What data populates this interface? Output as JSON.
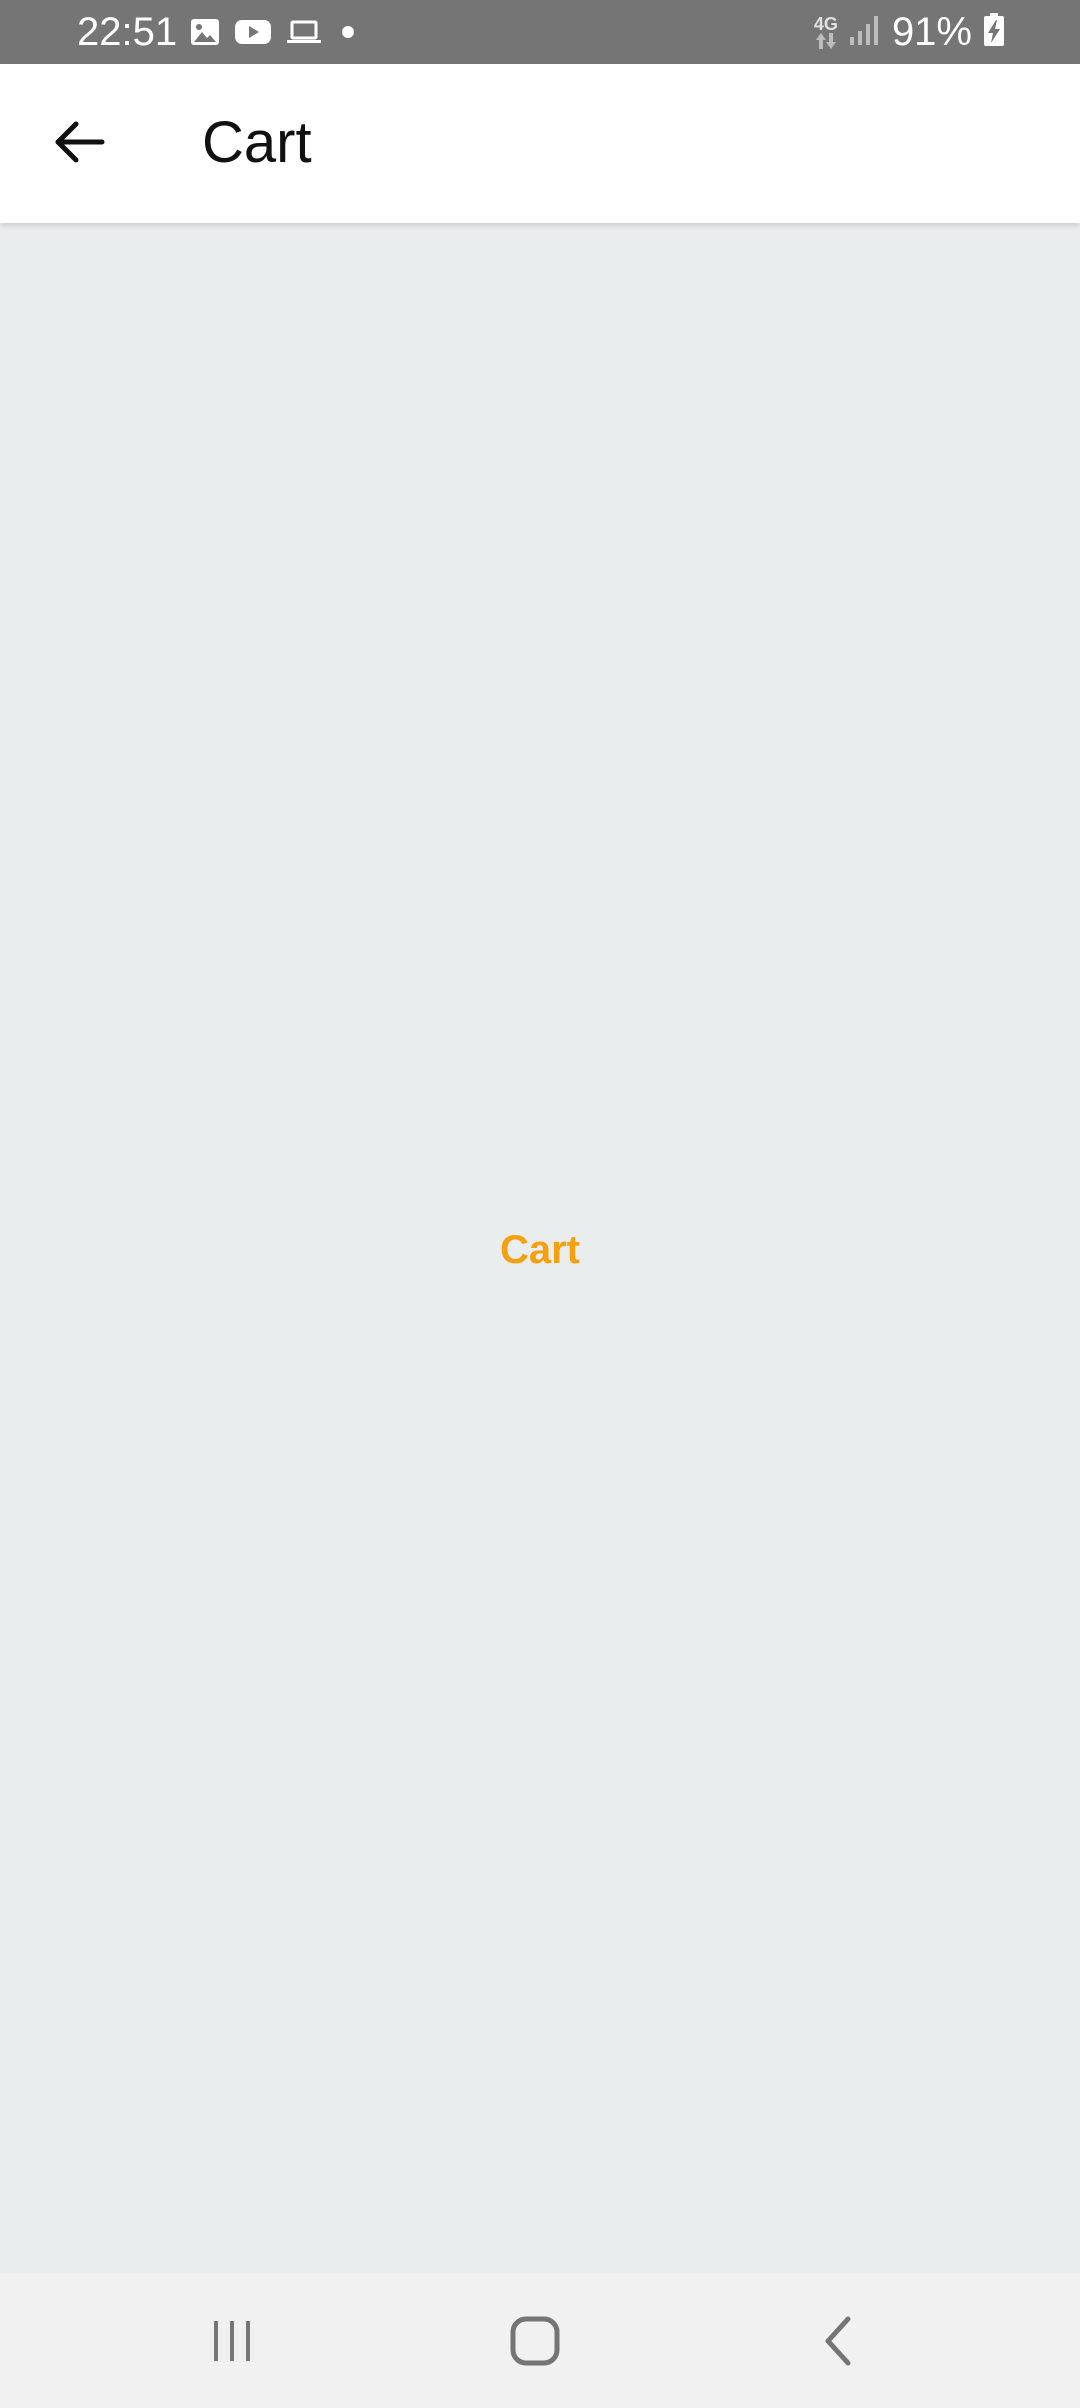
{
  "status_bar": {
    "time": "22:51",
    "notification_icons": [
      "image-icon",
      "youtube-icon",
      "laptop-icon",
      "dot-icon"
    ],
    "network": "4G",
    "battery": "91%"
  },
  "app_bar": {
    "title": "Cart",
    "back_icon": "arrow-left-icon"
  },
  "content": {
    "label": "Cart",
    "label_color": "#f5a10f",
    "background": "#eaedee"
  },
  "nav_bar": {
    "buttons": [
      "recent-apps-icon",
      "home-icon",
      "back-icon"
    ]
  }
}
